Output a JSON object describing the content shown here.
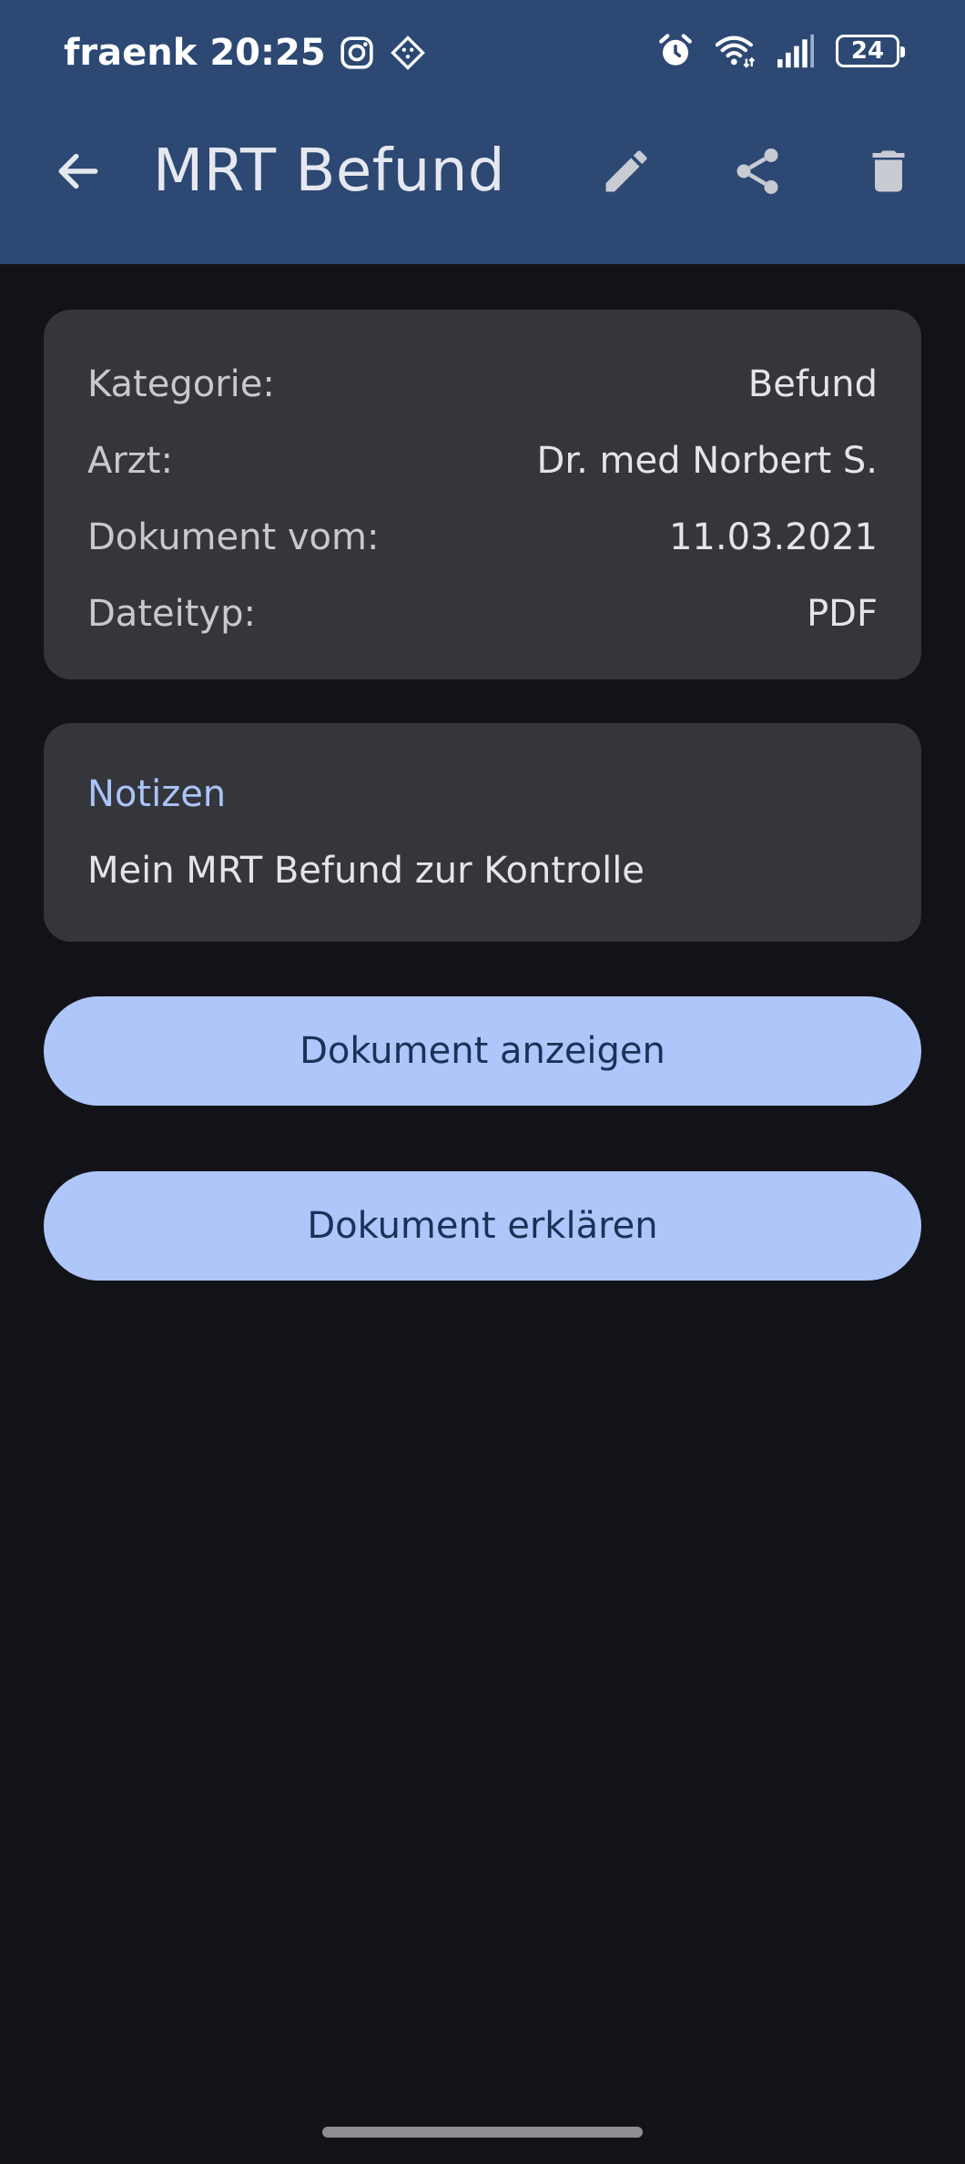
{
  "status_bar": {
    "carrier": "fraenk",
    "time": "20:25",
    "battery": "24",
    "icons": [
      "instagram-icon",
      "app-badge-icon",
      "alarm-icon",
      "wifi-icon",
      "signal-icon",
      "battery-icon"
    ]
  },
  "app_bar": {
    "title": "MRT Befund",
    "icons": [
      "back-arrow-icon",
      "edit-icon",
      "share-icon",
      "delete-icon"
    ]
  },
  "details": [
    {
      "label": "Kategorie:",
      "value": "Befund"
    },
    {
      "label": "Arzt:",
      "value": "Dr. med Norbert S."
    },
    {
      "label": "Dokument vom:",
      "value": "11.03.2021"
    },
    {
      "label": "Dateityp:",
      "value": "PDF"
    }
  ],
  "notes": {
    "title": "Notizen",
    "text": "Mein MRT Befund zur Kontrolle"
  },
  "buttons": {
    "view_label": "Dokument anzeigen",
    "explain_label": "Dokument erklären"
  },
  "colors": {
    "app_bar": "#2c4873",
    "background": "#121318",
    "card": "#35363b",
    "accent": "#aec6fa",
    "button_text": "#1b3157",
    "notes_title": "#aac4f8"
  }
}
